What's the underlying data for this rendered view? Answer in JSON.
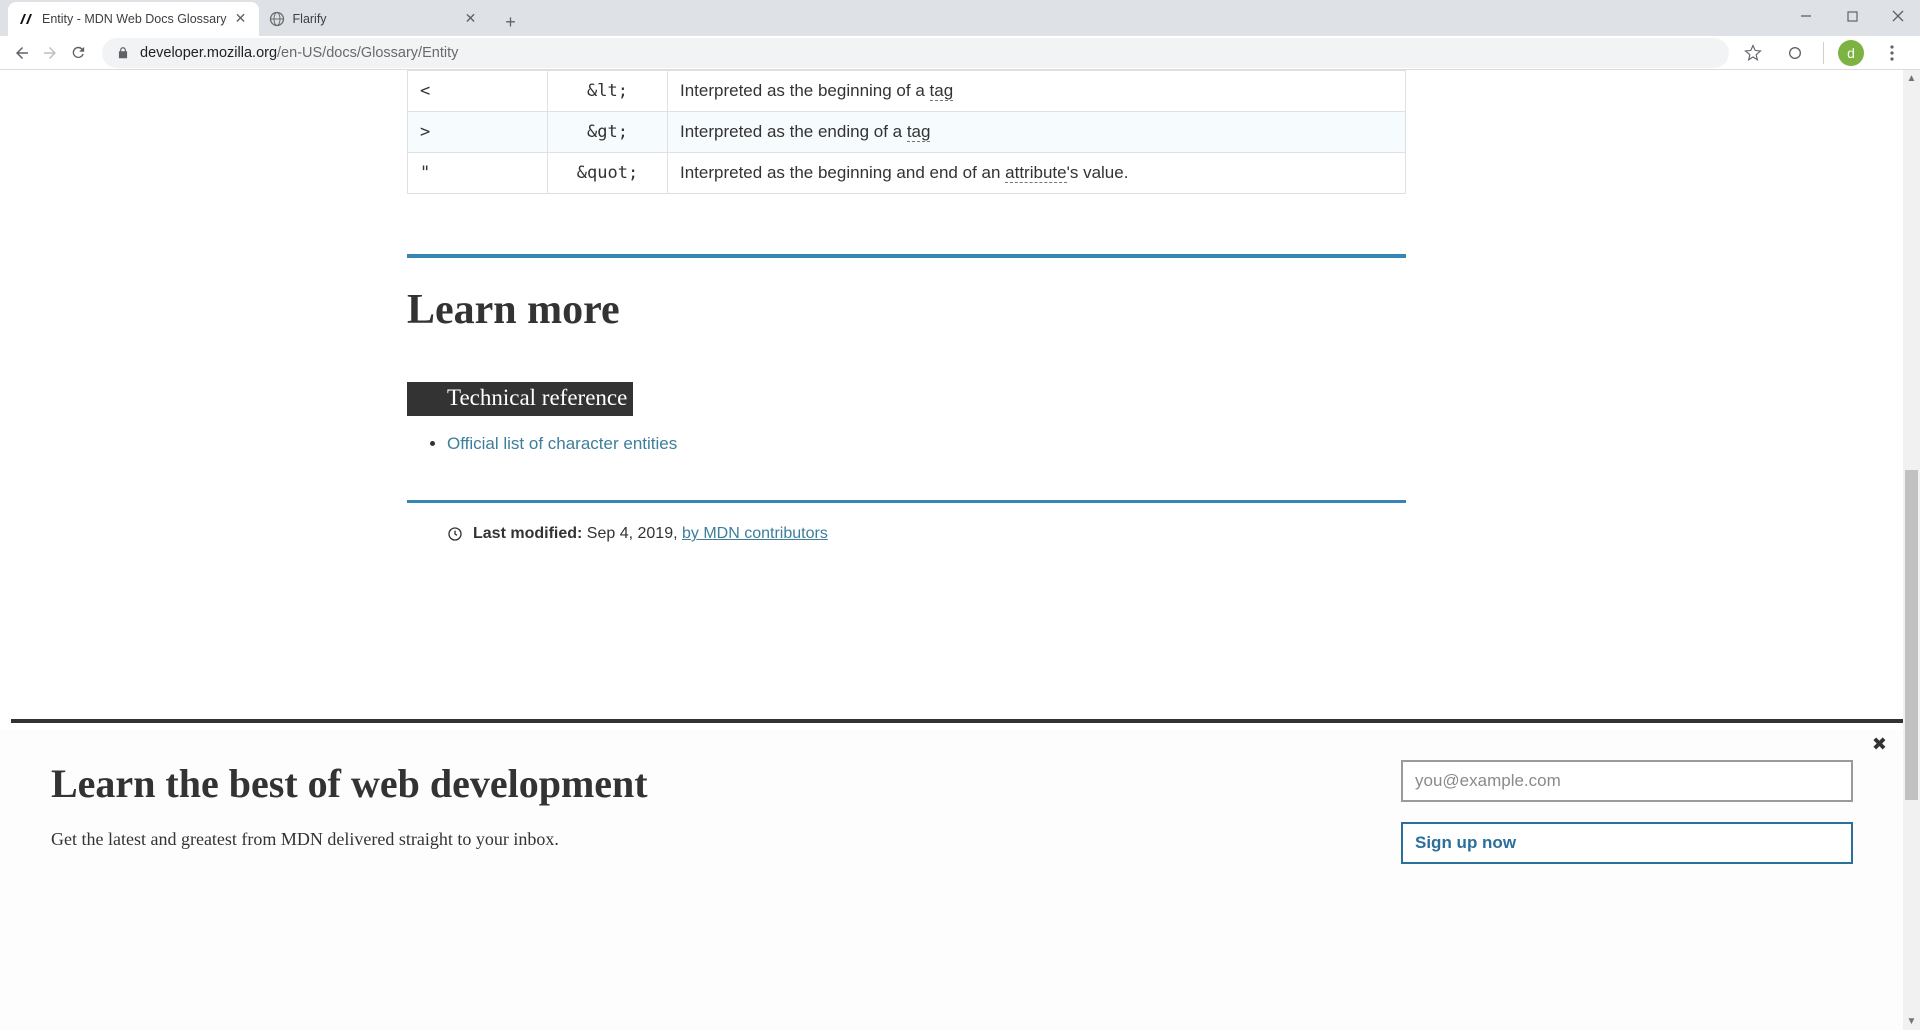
{
  "browser": {
    "tabs": [
      {
        "title": "Entity - MDN Web Docs Glossary",
        "active": true
      },
      {
        "title": "Flarify",
        "active": false
      }
    ],
    "url_host": "developer.mozilla.org",
    "url_path": "/en-US/docs/Glossary/Entity",
    "avatar_letter": "d"
  },
  "table_rows": [
    {
      "char": "<",
      "entity": "&lt;",
      "note_pre": "Interpreted as the beginning of a ",
      "term": "tag",
      "note_post": ""
    },
    {
      "char": ">",
      "entity": "&gt;",
      "note_pre": "Interpreted as the ending of a ",
      "term": "tag",
      "note_post": ""
    },
    {
      "char": "\"",
      "entity": "&quot;",
      "note_pre": "Interpreted as the beginning and end of an ",
      "term": "attribute",
      "note_post": "'s value."
    }
  ],
  "headings": {
    "learn_more": "Learn more",
    "tech_ref": "Technical reference"
  },
  "links": {
    "official_list": "Official list of character entities"
  },
  "lastmod": {
    "label": "Last modified:",
    "date": "Sep 4, 2019,",
    "contributors": "by MDN contributors"
  },
  "newsletter": {
    "heading": "Learn the best of web development",
    "subheading": "Get the latest and greatest from MDN delivered straight to your inbox.",
    "email_placeholder": "you@example.com",
    "signup_label": "Sign up now"
  }
}
